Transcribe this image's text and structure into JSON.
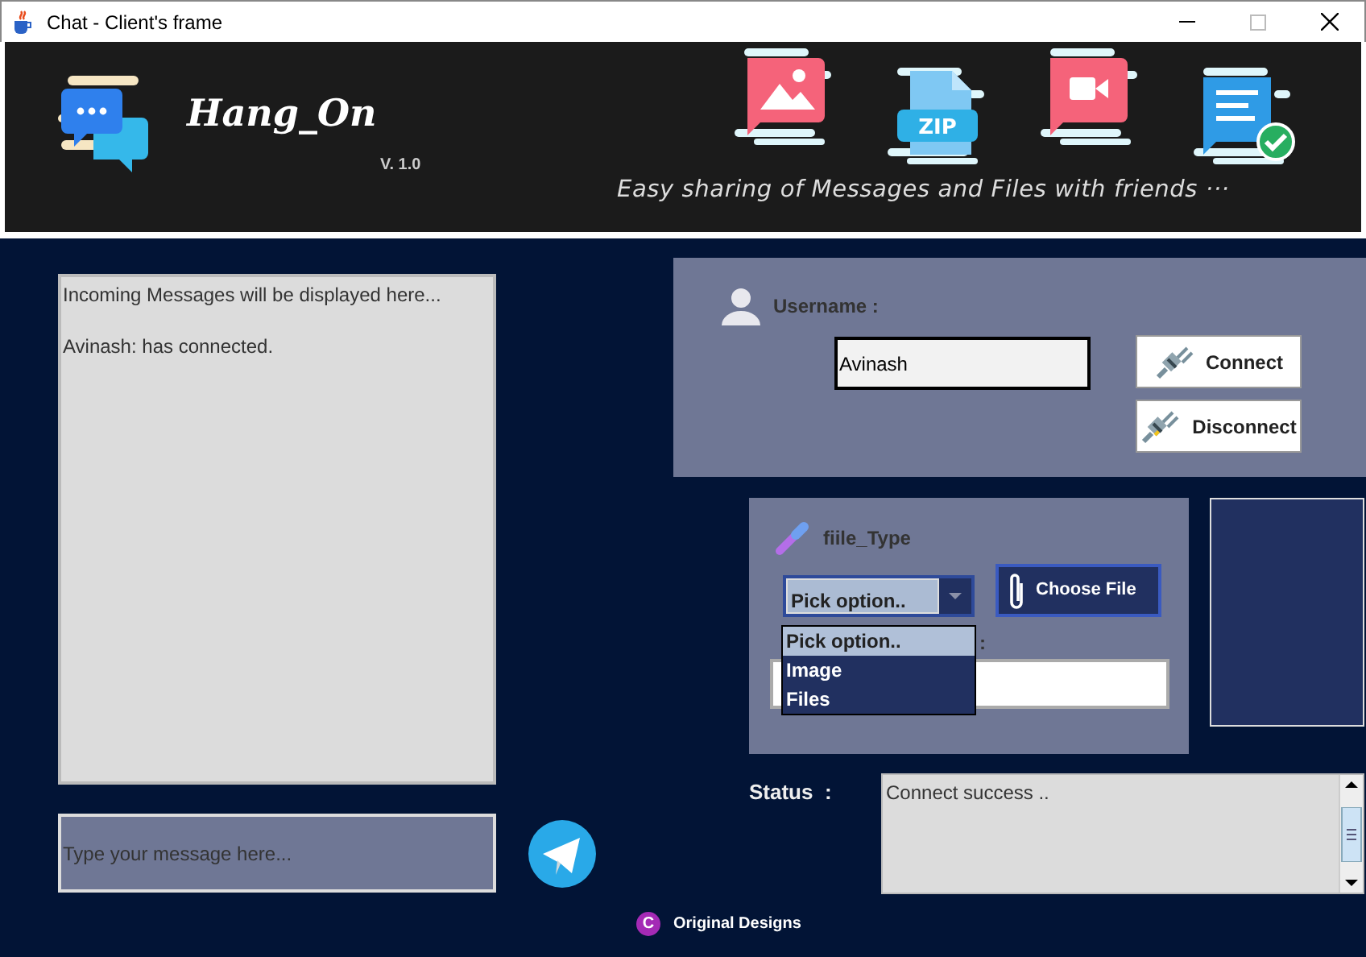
{
  "window": {
    "title": "Chat - Client's frame",
    "maximize_disabled": true
  },
  "header": {
    "app_name": "Hang_On",
    "version": "V. 1.0",
    "zip_label": "ZIP",
    "tagline": "Easy sharing of Messages and Files with friends ···"
  },
  "messages": {
    "lines": [
      "Incoming Messages will be displayed here...",
      "Avinash: has connected."
    ]
  },
  "compose": {
    "placeholder": "Type your message here..."
  },
  "user": {
    "label": "Username :",
    "value": "Avinash"
  },
  "connection_buttons": [
    {
      "label": "Connect",
      "kind": "connect"
    },
    {
      "label": "Disconnect",
      "kind": "disconnect"
    }
  ],
  "file": {
    "label": "fiile_Type",
    "select": {
      "value": "Pick option..",
      "expanded": true,
      "options": [
        {
          "label": "Pick option..",
          "selected": true
        },
        {
          "label": "Image",
          "selected": false
        },
        {
          "label": "Files",
          "selected": false
        }
      ]
    },
    "choose_button": "Choose File",
    "name_label_tail": ":"
  },
  "status": {
    "label": "Status  :",
    "text": "Connect success .."
  },
  "footer": {
    "badge": "C",
    "text": "Original Designs"
  }
}
